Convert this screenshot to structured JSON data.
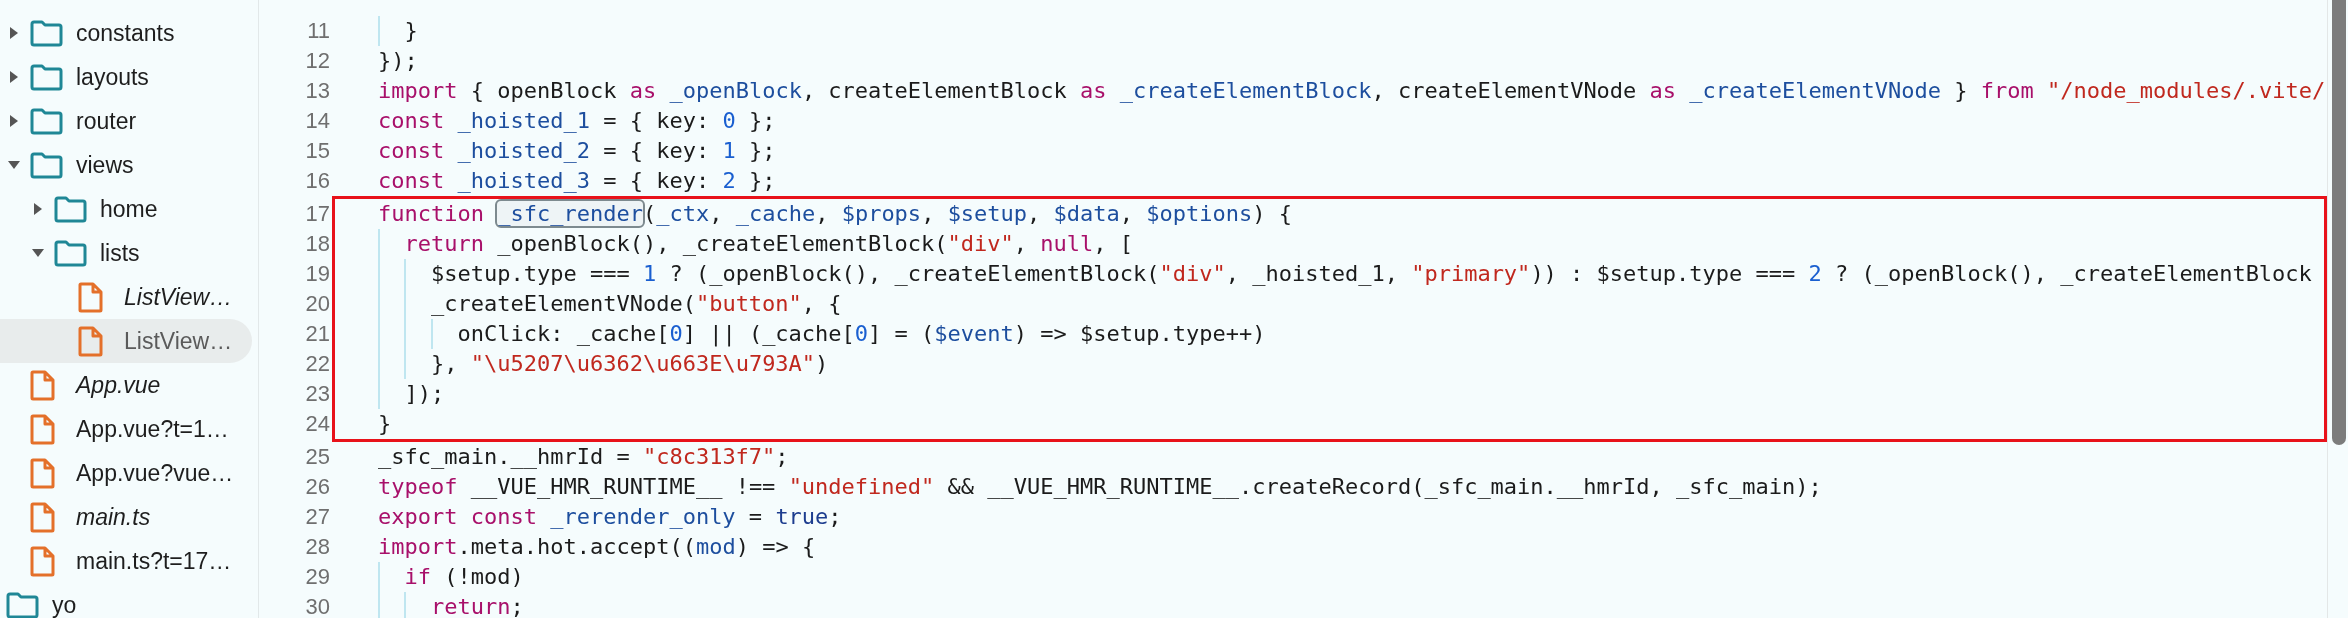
{
  "sidebar": {
    "items": [
      {
        "name": "constants",
        "kind": "folder",
        "expanded": false,
        "selected": false,
        "italic": false
      },
      {
        "name": "layouts",
        "kind": "folder",
        "expanded": false,
        "selected": false,
        "italic": false
      },
      {
        "name": "router",
        "kind": "folder",
        "expanded": false,
        "selected": false,
        "italic": false
      },
      {
        "name": "views",
        "kind": "folder",
        "expanded": true,
        "selected": false,
        "italic": false,
        "children": [
          {
            "name": "home",
            "kind": "folder",
            "expanded": false,
            "selected": false,
            "italic": false
          },
          {
            "name": "lists",
            "kind": "folder",
            "expanded": true,
            "selected": false,
            "italic": false,
            "children": [
              {
                "name": "ListView…",
                "kind": "file",
                "selected": false,
                "italic": true
              },
              {
                "name": "ListView…",
                "kind": "file",
                "selected": true,
                "italic": false
              }
            ]
          }
        ]
      },
      {
        "name": "App.vue",
        "kind": "file",
        "selected": false,
        "italic": true
      },
      {
        "name": "App.vue?t=1…",
        "kind": "file",
        "selected": false,
        "italic": false
      },
      {
        "name": "App.vue?vue…",
        "kind": "file",
        "selected": false,
        "italic": false
      },
      {
        "name": "main.ts",
        "kind": "file",
        "selected": false,
        "italic": true
      },
      {
        "name": "main.ts?t=17…",
        "kind": "file",
        "selected": false,
        "italic": false
      }
    ],
    "outer_items": [
      {
        "name": "yo",
        "kind": "folder",
        "selected": false,
        "italic": false
      }
    ]
  },
  "code": {
    "blocks": [
      {
        "boxed": false,
        "lines": [
          {
            "number": "11",
            "tokens": [
              {
                "kind": "plain",
                "text": "  }"
              }
            ]
          },
          {
            "number": "12",
            "tokens": [
              {
                "kind": "plain",
                "text": "});"
              }
            ]
          },
          {
            "number": "13",
            "tokens": [
              {
                "kind": "keyword",
                "text": "import"
              },
              {
                "kind": "plain",
                "text": " { openBlock "
              },
              {
                "kind": "keyword",
                "text": "as "
              },
              {
                "kind": "def",
                "text": "_openBlock"
              },
              {
                "kind": "plain",
                "text": ", createElementBlock "
              },
              {
                "kind": "keyword",
                "text": "as "
              },
              {
                "kind": "def",
                "text": "_createElementBlock"
              },
              {
                "kind": "plain",
                "text": ", createElementVNode "
              },
              {
                "kind": "keyword",
                "text": "as "
              },
              {
                "kind": "def",
                "text": "_createElementVNode"
              },
              {
                "kind": "plain",
                "text": " } "
              },
              {
                "kind": "keyword",
                "text": "from "
              },
              {
                "kind": "string",
                "text": "\"/node_modules/.vite/"
              }
            ]
          },
          {
            "number": "14",
            "tokens": [
              {
                "kind": "keyword",
                "text": "const "
              },
              {
                "kind": "def",
                "text": "_hoisted_1"
              },
              {
                "kind": "plain",
                "text": " = { key: "
              },
              {
                "kind": "number",
                "text": "0"
              },
              {
                "kind": "plain",
                "text": " };"
              }
            ]
          },
          {
            "number": "15",
            "tokens": [
              {
                "kind": "keyword",
                "text": "const "
              },
              {
                "kind": "def",
                "text": "_hoisted_2"
              },
              {
                "kind": "plain",
                "text": " = { key: "
              },
              {
                "kind": "number",
                "text": "1"
              },
              {
                "kind": "plain",
                "text": " };"
              }
            ]
          },
          {
            "number": "16",
            "tokens": [
              {
                "kind": "keyword",
                "text": "const "
              },
              {
                "kind": "def",
                "text": "_hoisted_3"
              },
              {
                "kind": "plain",
                "text": " = { key: "
              },
              {
                "kind": "number",
                "text": "2"
              },
              {
                "kind": "plain",
                "text": " };"
              }
            ]
          }
        ]
      },
      {
        "boxed": true,
        "lines": [
          {
            "number": "17",
            "tokens": [
              {
                "kind": "keyword",
                "text": "function "
              },
              {
                "kind": "def",
                "text": "_sfc_render",
                "highlighted": true
              },
              {
                "kind": "plain",
                "text": "("
              },
              {
                "kind": "def",
                "text": "_ctx"
              },
              {
                "kind": "plain",
                "text": ", "
              },
              {
                "kind": "def",
                "text": "_cache"
              },
              {
                "kind": "plain",
                "text": ", "
              },
              {
                "kind": "def",
                "text": "$props"
              },
              {
                "kind": "plain",
                "text": ", "
              },
              {
                "kind": "def",
                "text": "$setup"
              },
              {
                "kind": "plain",
                "text": ", "
              },
              {
                "kind": "def",
                "text": "$data"
              },
              {
                "kind": "plain",
                "text": ", "
              },
              {
                "kind": "def",
                "text": "$options"
              },
              {
                "kind": "plain",
                "text": ") {"
              }
            ]
          },
          {
            "number": "18",
            "tokens": [
              {
                "kind": "keyword",
                "text": "  return"
              },
              {
                "kind": "plain",
                "text": " _openBlock(), _createElementBlock("
              },
              {
                "kind": "string",
                "text": "\"div\""
              },
              {
                "kind": "plain",
                "text": ", "
              },
              {
                "kind": "keyword",
                "text": "null"
              },
              {
                "kind": "plain",
                "text": ", ["
              }
            ]
          },
          {
            "number": "19",
            "tokens": [
              {
                "kind": "plain",
                "text": "    $setup.type === "
              },
              {
                "kind": "number",
                "text": "1"
              },
              {
                "kind": "plain",
                "text": " ? (_openBlock(), _createElementBlock("
              },
              {
                "kind": "string",
                "text": "\"div\""
              },
              {
                "kind": "plain",
                "text": ", _hoisted_1, "
              },
              {
                "kind": "string",
                "text": "\"primary\""
              },
              {
                "kind": "plain",
                "text": ")) : $setup.type === "
              },
              {
                "kind": "number",
                "text": "2"
              },
              {
                "kind": "plain",
                "text": " ? (_openBlock(), _createElementBlock"
              }
            ]
          },
          {
            "number": "20",
            "tokens": [
              {
                "kind": "plain",
                "text": "    _createElementVNode("
              },
              {
                "kind": "string",
                "text": "\"button\""
              },
              {
                "kind": "plain",
                "text": ", {"
              }
            ]
          },
          {
            "number": "21",
            "tokens": [
              {
                "kind": "plain",
                "text": "      onClick: _cache["
              },
              {
                "kind": "number",
                "text": "0"
              },
              {
                "kind": "plain",
                "text": "] || (_cache["
              },
              {
                "kind": "number",
                "text": "0"
              },
              {
                "kind": "plain",
                "text": "] = ("
              },
              {
                "kind": "def",
                "text": "$event"
              },
              {
                "kind": "plain",
                "text": ") => $setup.type++)"
              }
            ]
          },
          {
            "number": "22",
            "tokens": [
              {
                "kind": "plain",
                "text": "    }, "
              },
              {
                "kind": "string",
                "text": "\"\\u5207\\u6362\\u663E\\u793A\""
              },
              {
                "kind": "plain",
                "text": ")"
              }
            ]
          },
          {
            "number": "23",
            "tokens": [
              {
                "kind": "plain",
                "text": "  ]);"
              }
            ]
          },
          {
            "number": "24",
            "tokens": [
              {
                "kind": "plain",
                "text": "}"
              }
            ]
          }
        ]
      },
      {
        "boxed": false,
        "lines": [
          {
            "number": "25",
            "tokens": [
              {
                "kind": "plain",
                "text": "_sfc_main.__hmrId = "
              },
              {
                "kind": "string",
                "text": "\"c8c313f7\""
              },
              {
                "kind": "plain",
                "text": ";"
              }
            ]
          },
          {
            "number": "26",
            "tokens": [
              {
                "kind": "keyword",
                "text": "typeof"
              },
              {
                "kind": "plain",
                "text": " __VUE_HMR_RUNTIME__ !== "
              },
              {
                "kind": "string",
                "text": "\"undefined\""
              },
              {
                "kind": "plain",
                "text": " && __VUE_HMR_RUNTIME__.createRecord(_sfc_main.__hmrId, _sfc_main);"
              }
            ]
          },
          {
            "number": "27",
            "tokens": [
              {
                "kind": "keyword",
                "text": "export const "
              },
              {
                "kind": "def",
                "text": "_rerender_only"
              },
              {
                "kind": "plain",
                "text": " = "
              },
              {
                "kind": "atom",
                "text": "true"
              },
              {
                "kind": "plain",
                "text": ";"
              }
            ]
          },
          {
            "number": "28",
            "tokens": [
              {
                "kind": "keyword",
                "text": "import"
              },
              {
                "kind": "plain",
                "text": ".meta.hot.accept(("
              },
              {
                "kind": "def",
                "text": "mod"
              },
              {
                "kind": "plain",
                "text": ") => {"
              }
            ]
          },
          {
            "number": "29",
            "tokens": [
              {
                "kind": "keyword",
                "text": "  if"
              },
              {
                "kind": "plain",
                "text": " (!mod)"
              }
            ]
          },
          {
            "number": "30",
            "tokens": [
              {
                "kind": "keyword",
                "text": "    return"
              },
              {
                "kind": "plain",
                "text": ";"
              }
            ]
          }
        ]
      }
    ]
  }
}
